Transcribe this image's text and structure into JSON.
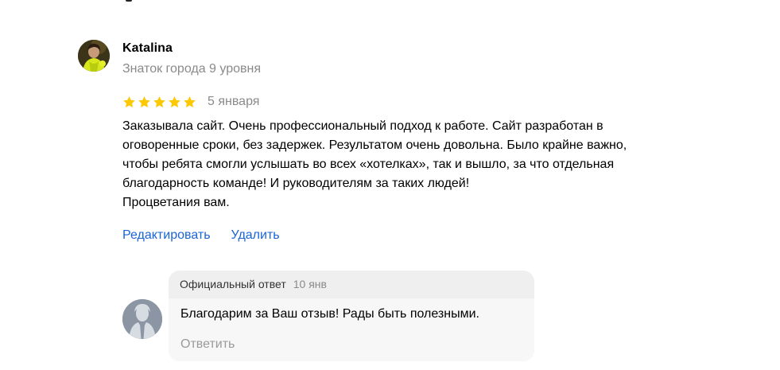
{
  "review": {
    "author": {
      "name": "Katalina",
      "level": "Знаток города 9 уровня",
      "avatar_icon": "user-photo-avatar"
    },
    "rating": {
      "stars": 5,
      "max": 5,
      "star_color": "#fcc800"
    },
    "date": "5 января",
    "text_lines": [
      "Заказывала сайт. Очень профессиональный подход к работе. Сайт разработан в",
      "оговоренные сроки, без задержек. Результатом очень довольна. Было крайне важно,",
      "чтобы ребята смогли услышать во всех «хотелках», так и вышло, за что отдельная",
      "благодарность команде! И руководителям за таких людей!",
      "Процветания вам."
    ],
    "actions": {
      "edit_label": "Редактировать",
      "delete_label": "Удалить"
    },
    "link_color": "#1a64d8"
  },
  "official_reply": {
    "label": "Официальный ответ",
    "date": "10 янв",
    "text": "Благодарим за Ваш отзыв! Рады быть полезными.",
    "reply_label": "Ответить",
    "avatar_icon": "business-person-silhouette-icon"
  }
}
